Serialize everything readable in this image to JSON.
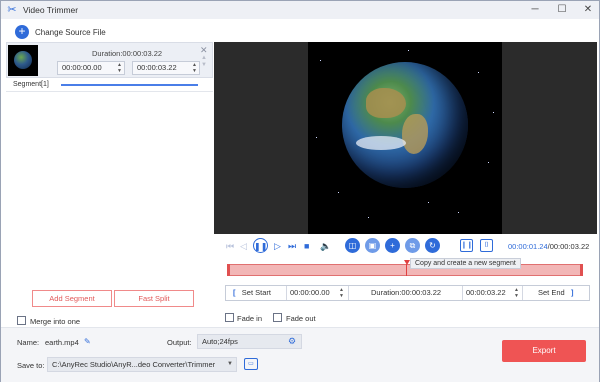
{
  "window": {
    "title": "Video Trimmer",
    "app_icon": "scissors-icon",
    "controls": [
      "minimize-icon",
      "maximize-icon",
      "close-icon"
    ]
  },
  "toolbar": {
    "change_source_label": "Change Source File",
    "add_icon": "plus-circle-icon"
  },
  "segment_list": {
    "items": [
      {
        "duration_label": "Duration:00:00:03.22",
        "start": "00:00:00.00",
        "end": "00:00:03.22"
      }
    ],
    "segment_label": "Segment[1]",
    "add_segment_label": "Add Segment",
    "fast_split_label": "Fast Split",
    "merge_label": "Merge into one",
    "merge_checked": false
  },
  "player": {
    "current_time": "00:00:01.24",
    "total_time": "/00:00:03.22",
    "tooltip": "Copy and create a new segment",
    "playhead_fraction": 0.39
  },
  "range": {
    "set_start_label": "Set Start",
    "start": "00:00:00.00",
    "duration_label": "Duration:00:00:03.22",
    "end": "00:00:03.22",
    "set_end_label": "Set End"
  },
  "fades": {
    "fade_in_label": "Fade in",
    "fade_out_label": "Fade out",
    "fade_in_checked": false,
    "fade_out_checked": false
  },
  "output": {
    "name_label": "Name:",
    "name_value": "earth.mp4",
    "output_label": "Output:",
    "output_value": "Auto;24fps",
    "save_label": "Save to:",
    "save_path": "C:\\AnyRec Studio\\AnyR...deo Converter\\Trimmer",
    "export_label": "Export"
  },
  "colors": {
    "accent": "#2f6bd9",
    "export": "#ef5454",
    "timeline": "#f2b6b6"
  }
}
